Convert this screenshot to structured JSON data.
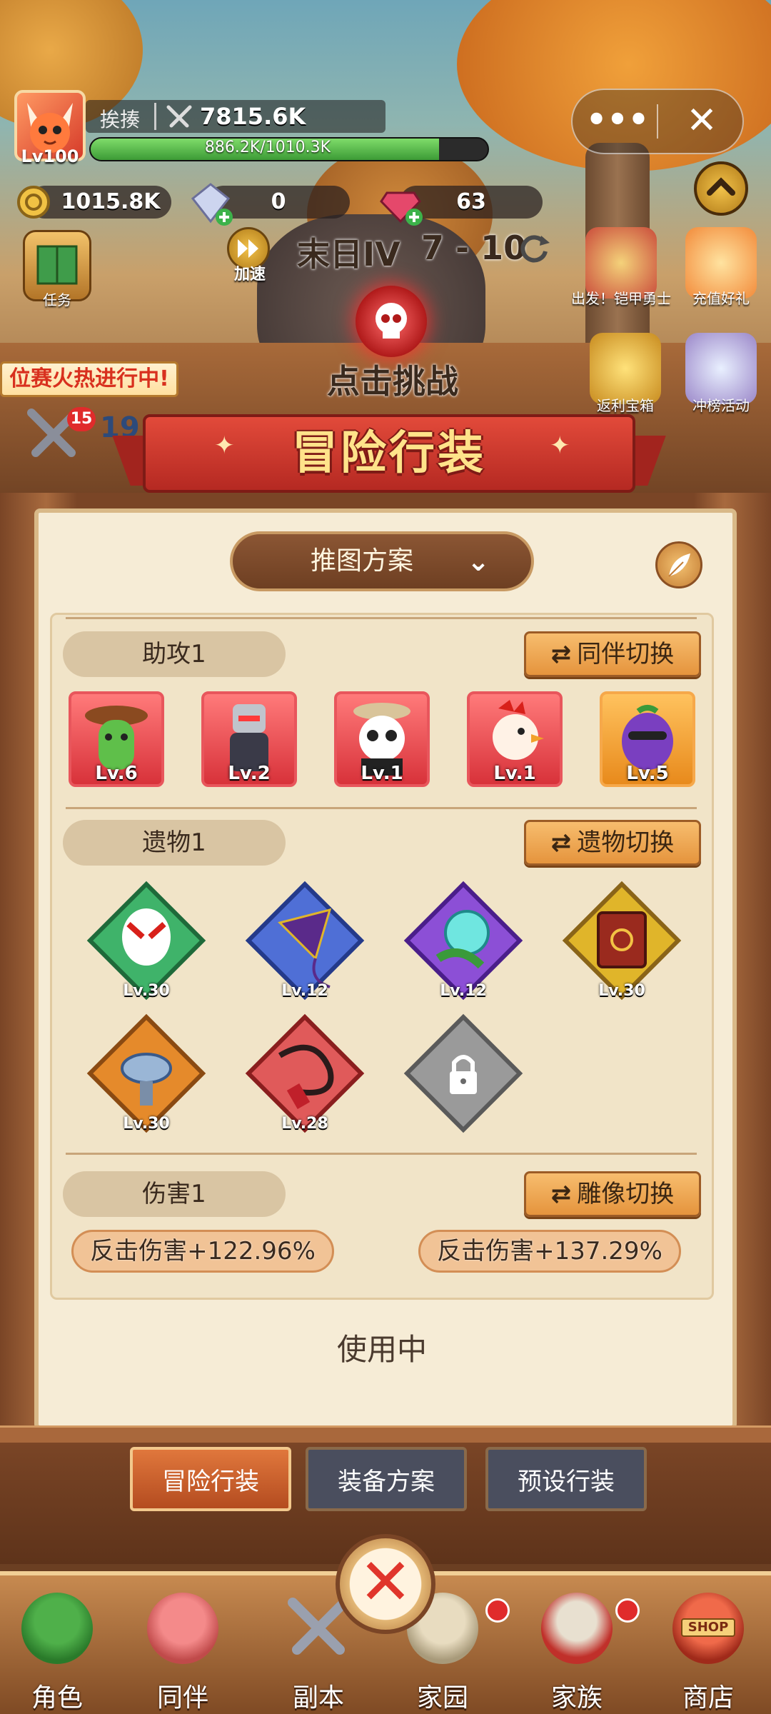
{
  "player": {
    "name": "挨揍",
    "power": "7815.6K",
    "level": "Lv100",
    "hp_text": "886.2K/1010.3K",
    "hp_fraction": 0.877
  },
  "currency": {
    "gold": "1015.8K",
    "crystal": "0",
    "gem": "63"
  },
  "stage": {
    "speed_label": "加速",
    "name": "末日IV",
    "progress": "7 - 10",
    "challenge_label": "点击挑战"
  },
  "left_menu": {
    "task_label": "任务",
    "event_banner": "位赛火热进行中!",
    "badge_count": "15",
    "partial_number": "19"
  },
  "right_menu": [
    {
      "label": "出发！铠甲勇士"
    },
    {
      "label": "充值好礼"
    },
    {
      "label": "返利宝箱"
    },
    {
      "label": "冲榜活动"
    }
  ],
  "banner": {
    "title": "冒险行装"
  },
  "scheme": {
    "label": "推图方案"
  },
  "assist": {
    "tag": "助攻1",
    "switch_label": "同伴切换",
    "heroes": [
      {
        "level": "Lv.6"
      },
      {
        "level": "Lv.2"
      },
      {
        "level": "Lv.1"
      },
      {
        "level": "Lv.1"
      },
      {
        "level": "Lv.5"
      }
    ]
  },
  "relics": {
    "tag": "遗物1",
    "switch_label": "遗物切换",
    "items": [
      {
        "level": "Lv.30",
        "color": "#3fb36a"
      },
      {
        "level": "Lv.12",
        "color": "#4f6fd6"
      },
      {
        "level": "Lv.12",
        "color": "#8c4fd6"
      },
      {
        "level": "Lv.30",
        "color": "#e0b52a"
      },
      {
        "level": "Lv.30",
        "color": "#e58a2b"
      },
      {
        "level": "Lv.28",
        "color": "#e05a5a"
      }
    ]
  },
  "damage": {
    "tag": "伤害1",
    "switch_label": "雕像切换",
    "bonus_1": "反击伤害+122.96%",
    "bonus_2": "反击伤害+137.29%"
  },
  "status": "使用中",
  "subtabs": {
    "tab1": "冒险行装",
    "tab2": "装备方案",
    "tab3": "预设行装"
  },
  "nav": {
    "role": "角色",
    "partner": "同伴",
    "dungeon": "副本",
    "home": "家园",
    "clan": "家族",
    "shop": "商店",
    "shop_sign": "SHOP"
  }
}
